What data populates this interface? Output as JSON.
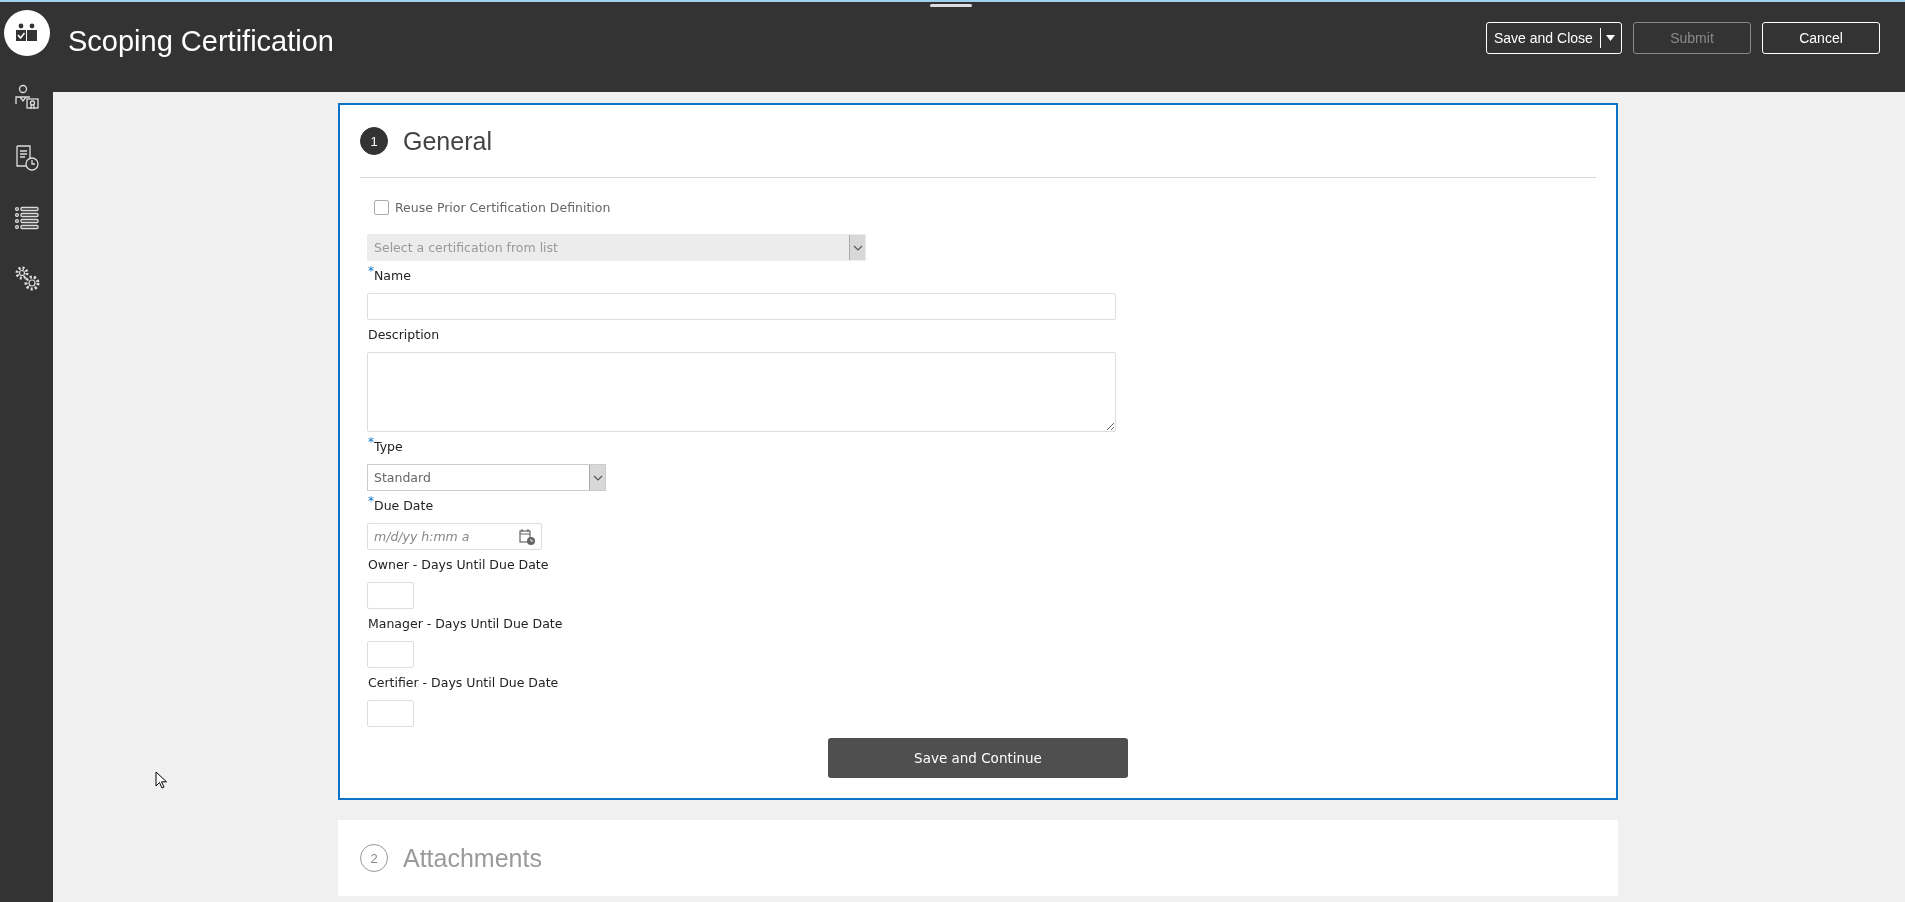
{
  "header": {
    "title": "Scoping Certification",
    "buttons": [
      {
        "label": "Save and Close",
        "kind": "split",
        "disabled": false
      },
      {
        "label": "Submit",
        "kind": "plain",
        "disabled": true
      },
      {
        "label": "Cancel",
        "kind": "plain",
        "disabled": false
      }
    ]
  },
  "sections": [
    {
      "number": "1",
      "title": "General",
      "active": true,
      "fields": [
        {
          "kind": "checkbox",
          "label": "Reuse Prior Certification Definition",
          "checked": false
        },
        {
          "kind": "select",
          "placeholder": "Select a certification from list",
          "disabled": true
        },
        {
          "kind": "text",
          "label": "$^{*}$Name"
        },
        {
          "kind": "textarea",
          "label": "Description"
        },
        {
          "kind": "select",
          "label": "$^{*}$Type",
          "value": "Standard",
          "disabled": false
        },
        {
          "kind": "date",
          "label": "$^{*}$Due Date",
          "placeholder": "m/d/yy h:mm a"
        },
        {
          "kind": "number",
          "label": "Owner - Days Until Due Date"
        },
        {
          "kind": "number",
          "label": "Manager - Days Until Due Date"
        },
        {
          "kind": "number",
          "label": "Certifier - Days Until Due Date"
        }
      ],
      "action": "Save and Continue"
    },
    {
      "number": "2",
      "title": "Attachments",
      "active": false
    }
  ]
}
